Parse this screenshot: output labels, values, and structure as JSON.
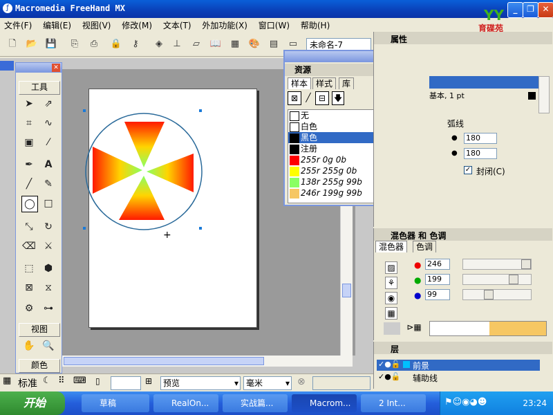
{
  "app": {
    "title": "Macromedia FreeHand MX"
  },
  "logo": {
    "text": "育碟苑"
  },
  "menu": [
    "文件(F)",
    "编辑(E)",
    "视图(V)",
    "修改(M)",
    "文本(T)",
    "外加功能(X)",
    "窗口(W)",
    "帮助(H)"
  ],
  "toolbar": {
    "doc_name": "未命名-7"
  },
  "tools": {
    "header": "工具",
    "view_header": "视图",
    "color_header": "颜色"
  },
  "swatches": {
    "title": "资源",
    "tabs": [
      "样本",
      "样式",
      "库"
    ],
    "rows": [
      {
        "label": "无",
        "color": "#ffffff",
        "rgb": ""
      },
      {
        "label": "白色",
        "color": "#ffffff",
        "rgb": ""
      },
      {
        "label": "黑色",
        "color": "#000000",
        "rgb": ""
      },
      {
        "label": "注册",
        "color": "#000000",
        "rgb": ""
      },
      {
        "label": "255r 0g 0b",
        "color": "#ff0000",
        "rgb": "RGB"
      },
      {
        "label": "255r 255g 0b",
        "color": "#ffff00",
        "rgb": "RGB"
      },
      {
        "label": "138r 255g 99b",
        "color": "#8aff63",
        "rgb": "RGB"
      },
      {
        "label": "246r 199g 99b",
        "color": "#f6c763",
        "rgb": "RGB"
      }
    ],
    "selected_index": 2
  },
  "properties": {
    "header": "属性",
    "stroke_text": "基本, 1 pt",
    "arc_label": "弧线",
    "arc_start": "180",
    "arc_end": "180",
    "closed_label": "封闭(C)"
  },
  "mixer": {
    "header": "混色器 和 色调",
    "tabs": [
      "混色器",
      "色调"
    ],
    "r": "246",
    "g": "199",
    "b": "99",
    "preview_color": "#f6c763"
  },
  "layers": {
    "header": "层",
    "items": [
      {
        "name": "前景",
        "selected": true
      },
      {
        "name": "辅助线",
        "selected": false
      }
    ]
  },
  "statusbar": {
    "mode": "标准",
    "view_mode": "预览",
    "units": "毫米"
  },
  "taskbar": {
    "start": "开始",
    "items": [
      "草稿",
      "RealOn...",
      "实战篇...",
      "Macrom...",
      "2 Int..."
    ],
    "clock": "23:24"
  }
}
